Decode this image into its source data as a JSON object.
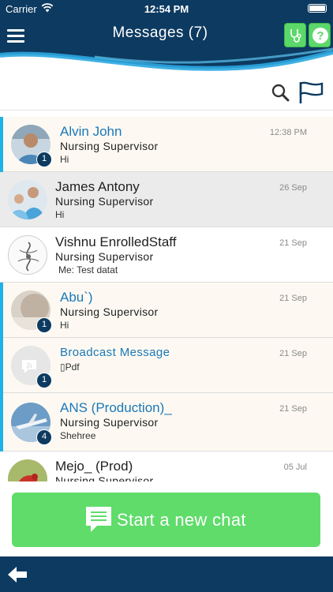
{
  "status_bar": {
    "carrier": "Carrier",
    "time": "12:54 PM"
  },
  "header": {
    "title": "Messages (7)",
    "menu_icon": "hamburger-menu-icon",
    "buttons": [
      "stethoscope-icon",
      "help-icon"
    ]
  },
  "toolbar": {
    "search_icon": "search-icon",
    "flag_icon": "flag-icon"
  },
  "conversations": [
    {
      "name": "Alvin John",
      "role": "Nursing Supervisor",
      "message": "Hi",
      "date": "12:38 PM",
      "badge": "1",
      "unread": true,
      "avatar": "person-photo-avatar"
    },
    {
      "name": "James Antony",
      "role": "Nursing Supervisor",
      "message": "Hi",
      "date": "26 Sep",
      "badge": "",
      "unread": false,
      "avatar": "medical-staff-photo-avatar"
    },
    {
      "name": "Vishnu EnrolledStaff",
      "role": "Nursing Supervisor",
      "message": "Me:  Test datat",
      "date": "21 Sep",
      "badge": "",
      "unread": false,
      "avatar": "ornament-drawing-avatar"
    },
    {
      "name": "Abu`)",
      "role": "Nursing Supervisor",
      "message": "Hi",
      "date": "21 Sep",
      "badge": "1",
      "unread": true,
      "avatar": "blurred-photo-avatar"
    },
    {
      "name": "Broadcast Message",
      "role": "",
      "message": "▯Pdf",
      "date": "21 Sep",
      "badge": "1",
      "unread": true,
      "avatar": "broadcast-icon-avatar"
    },
    {
      "name": "ANS (Production)_",
      "role": "Nursing Supervisor",
      "message": "Shehree",
      "date": "21 Sep",
      "badge": "4",
      "unread": true,
      "avatar": "airplane-photo-avatar"
    },
    {
      "name": "Mejo_ (Prod)",
      "role": "Nursing Supervisor",
      "message": "",
      "date": "05 Jul",
      "badge": "",
      "unread": false,
      "avatar": "bird-photo-avatar"
    }
  ],
  "start_chat": {
    "label": "Start a new chat",
    "icon": "chat-bubble-icon"
  },
  "bottom_bar": {
    "back_icon": "back-arrow-icon"
  },
  "colors": {
    "navy": "#0d3a60",
    "green": "#5fdc6a",
    "accent_blue": "#1fb2e6",
    "unread_name": "#1a78b8"
  }
}
